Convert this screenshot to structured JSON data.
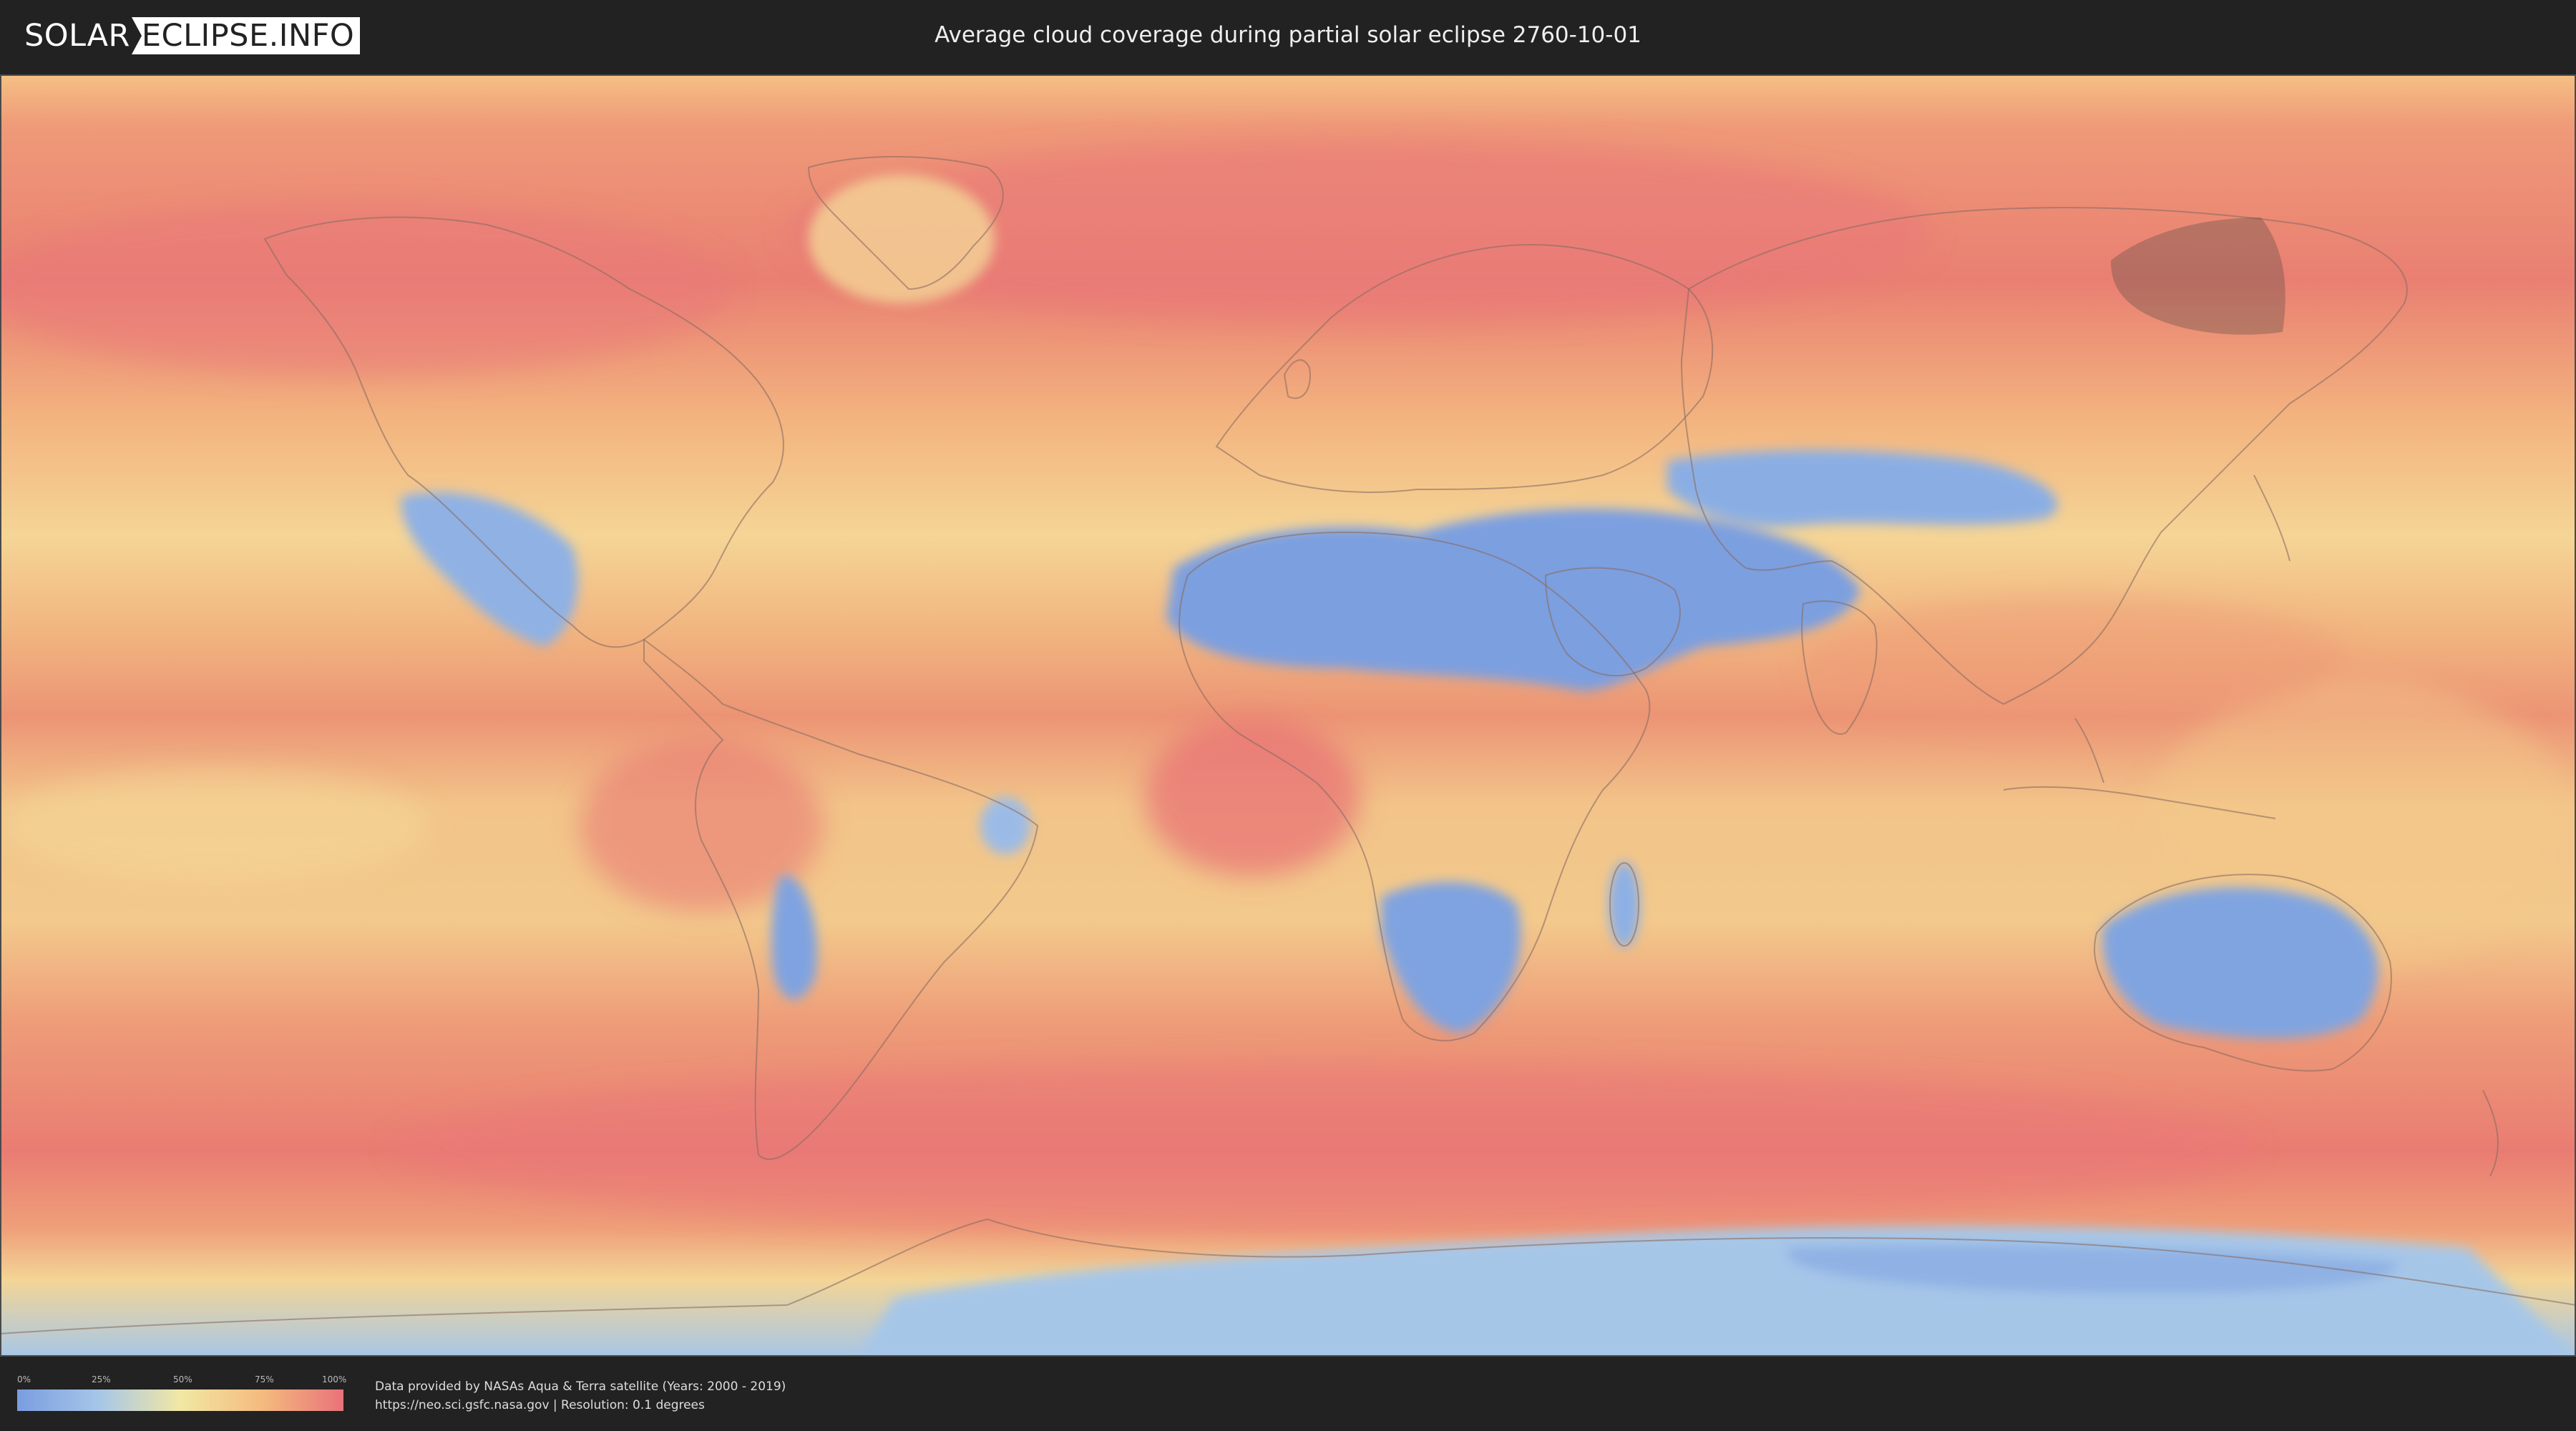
{
  "header": {
    "logo_left": "SOLAR",
    "logo_right": "ECLIPSE.INFO",
    "title": "Average cloud coverage during partial solar eclipse 2760-10-01"
  },
  "map": {
    "projection": "equirectangular",
    "colors": {
      "clear": "#7a9de0",
      "light": "#a6c6e8",
      "medium": "#f2e7a4",
      "high": "#f4bb7e",
      "overcast": "#e9727a",
      "eclipse_shadow": "#5a4a44"
    }
  },
  "legend": {
    "ticks": [
      "0%",
      "25%",
      "50%",
      "75%",
      "100%"
    ]
  },
  "footer": {
    "source_line1": "Data provided by NASAs Aqua & Terra satellite (Years: 2000 - 2019)",
    "source_line2": "https://neo.sci.gsfc.nasa.gov | Resolution: 0.1 degrees"
  }
}
